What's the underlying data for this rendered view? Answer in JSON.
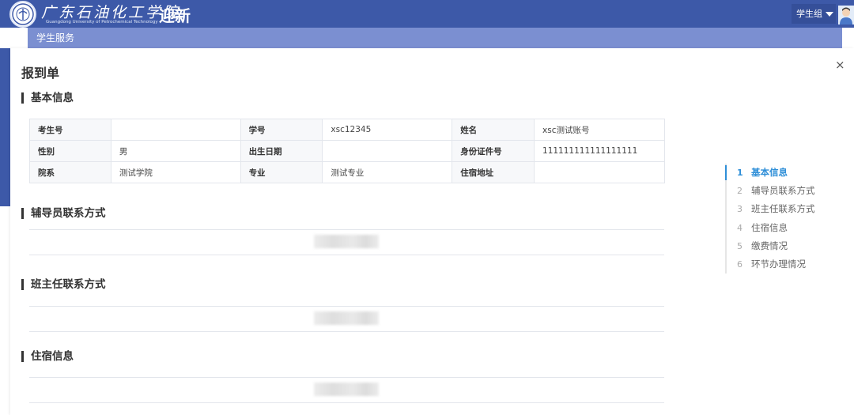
{
  "header": {
    "school_name": "广东石油化工学院",
    "school_en": "Guangdong University of Petrochemical Technology",
    "app_title": "迎新",
    "user_menu_label": "学生组"
  },
  "subnav": {
    "label": "学生服务"
  },
  "modal": {
    "title": "报到单",
    "close_label": "×",
    "sections": {
      "basic": "基本信息",
      "counselor": "辅导员联系方式",
      "head_teacher": "班主任联系方式",
      "accommodation": "住宿信息"
    },
    "basic_info": {
      "rows": [
        [
          "考生号",
          "",
          "学号",
          "xsc12345",
          "姓名",
          "xsc测试账号"
        ],
        [
          "性别",
          "男",
          "出生日期",
          "",
          "身份证件号",
          "111111111111111111"
        ],
        [
          "院系",
          "测试学院",
          "专业",
          "测试专业",
          "住宿地址",
          ""
        ]
      ]
    },
    "anchor_nav": [
      {
        "num": "1",
        "label": "基本信息"
      },
      {
        "num": "2",
        "label": "辅导员联系方式"
      },
      {
        "num": "3",
        "label": "班主任联系方式"
      },
      {
        "num": "4",
        "label": "住宿信息"
      },
      {
        "num": "5",
        "label": "缴费情况"
      },
      {
        "num": "6",
        "label": "环节办理情况"
      }
    ]
  },
  "colors": {
    "header_bg": "#3d59a8",
    "subnav_bg": "#7b8fd1",
    "anchor_active": "#2f8fd8"
  },
  "icons": {
    "logo": "school-emblem-icon",
    "user_menu_caret": "caret-down-icon",
    "close": "close-icon"
  }
}
